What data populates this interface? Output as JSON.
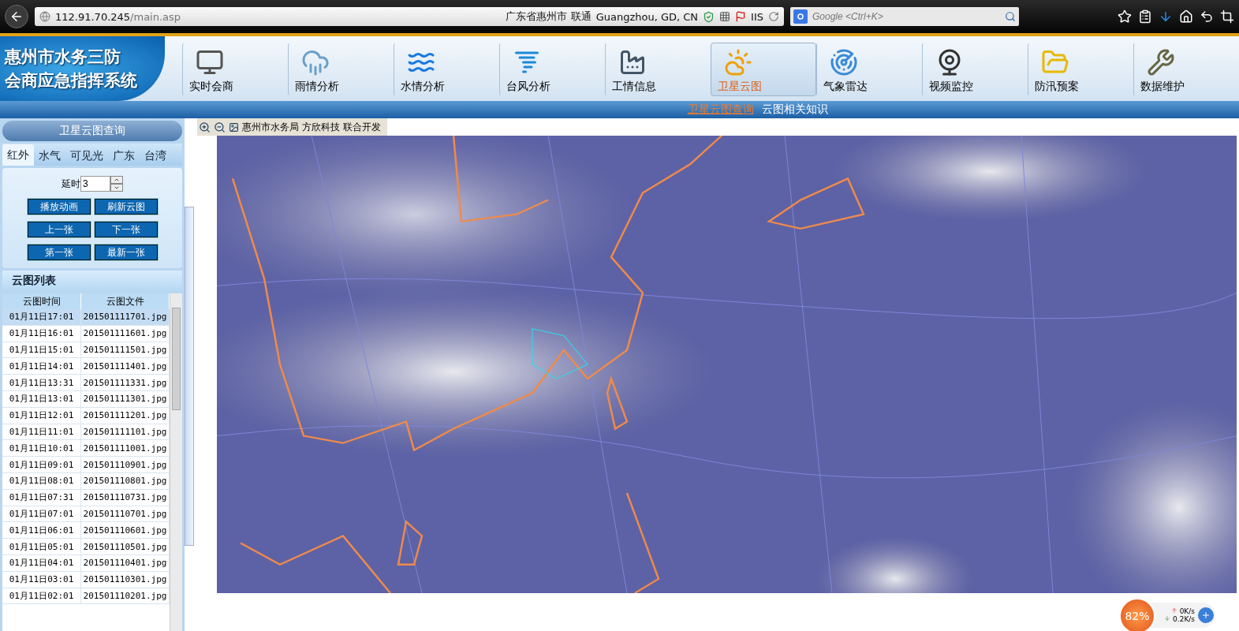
{
  "browser": {
    "url_host": "112.91.70.245",
    "url_path": "/main.asp",
    "location": "广东省惠州市 联通",
    "geo": "Guangzhou, GD, CN",
    "iis": "IIS",
    "search": {
      "placeholder": "Google <Ctrl+K>"
    }
  },
  "header": {
    "logo_lines": [
      "惠州市水务三防",
      "会商应急指挥系统"
    ],
    "nav": [
      {
        "label": "实时会商",
        "kind": "monitor",
        "selected": false
      },
      {
        "label": "雨情分析",
        "kind": "rain",
        "selected": false
      },
      {
        "label": "水情分析",
        "kind": "water",
        "selected": false
      },
      {
        "label": "台风分析",
        "kind": "typhoon",
        "selected": false
      },
      {
        "label": "工情信息",
        "kind": "dam",
        "selected": false
      },
      {
        "label": "卫星云图",
        "kind": "sun",
        "selected": true
      },
      {
        "label": "气象雷达",
        "kind": "radar",
        "selected": false
      },
      {
        "label": "视频监控",
        "kind": "camera",
        "selected": false
      },
      {
        "label": "防汛预案",
        "kind": "folder",
        "selected": false
      },
      {
        "label": "数据维护",
        "kind": "tools",
        "selected": false
      }
    ]
  },
  "subnav": [
    {
      "label": "卫星云图查询",
      "selected": true
    },
    {
      "label": "云图相关知识",
      "selected": false
    }
  ],
  "sidebar": {
    "title": "卫星云图查询",
    "tabs": [
      {
        "label": "红外",
        "selected": true
      },
      {
        "label": "水气",
        "selected": false
      },
      {
        "label": "可见光",
        "selected": false
      },
      {
        "label": "广东",
        "selected": false
      },
      {
        "label": "台湾",
        "selected": false
      }
    ],
    "delay_label": "延时",
    "delay_value": "3",
    "buttons": [
      "播放动画",
      "刷新云图",
      "上一张",
      "下一张",
      "第一张",
      "最新一张"
    ],
    "list_title": "云图列表",
    "columns": [
      "云图时间",
      "云图文件"
    ],
    "rows": [
      {
        "time": "01月11日17:01",
        "file": "201501111701.jpg",
        "selected": true
      },
      {
        "time": "01月11日16:01",
        "file": "201501111601.jpg",
        "selected": false
      },
      {
        "time": "01月11日15:01",
        "file": "201501111501.jpg",
        "selected": false
      },
      {
        "time": "01月11日14:01",
        "file": "201501111401.jpg",
        "selected": false
      },
      {
        "time": "01月11日13:31",
        "file": "201501111331.jpg",
        "selected": false
      },
      {
        "time": "01月11日13:01",
        "file": "201501111301.jpg",
        "selected": false
      },
      {
        "time": "01月11日12:01",
        "file": "201501111201.jpg",
        "selected": false
      },
      {
        "time": "01月11日11:01",
        "file": "201501111101.jpg",
        "selected": false
      },
      {
        "time": "01月11日10:01",
        "file": "201501111001.jpg",
        "selected": false
      },
      {
        "time": "01月11日09:01",
        "file": "201501110901.jpg",
        "selected": false
      },
      {
        "time": "01月11日08:01",
        "file": "201501110801.jpg",
        "selected": false
      },
      {
        "time": "01月11日07:31",
        "file": "201501110731.jpg",
        "selected": false
      },
      {
        "time": "01月11日07:01",
        "file": "201501110701.jpg",
        "selected": false
      },
      {
        "time": "01月11日06:01",
        "file": "201501110601.jpg",
        "selected": false
      },
      {
        "time": "01月11日05:01",
        "file": "201501110501.jpg",
        "selected": false
      },
      {
        "time": "01月11日04:01",
        "file": "201501110401.jpg",
        "selected": false
      },
      {
        "time": "01月11日03:01",
        "file": "201501110301.jpg",
        "selected": false
      },
      {
        "time": "01月11日02:01",
        "file": "201501110201.jpg",
        "selected": false
      }
    ]
  },
  "map_toolbar": {
    "credit": "惠州市水务局 方欣科技 联合开发"
  },
  "net_widget": {
    "percent": "82%",
    "up": "0K/s",
    "down": "0.2K/s"
  }
}
